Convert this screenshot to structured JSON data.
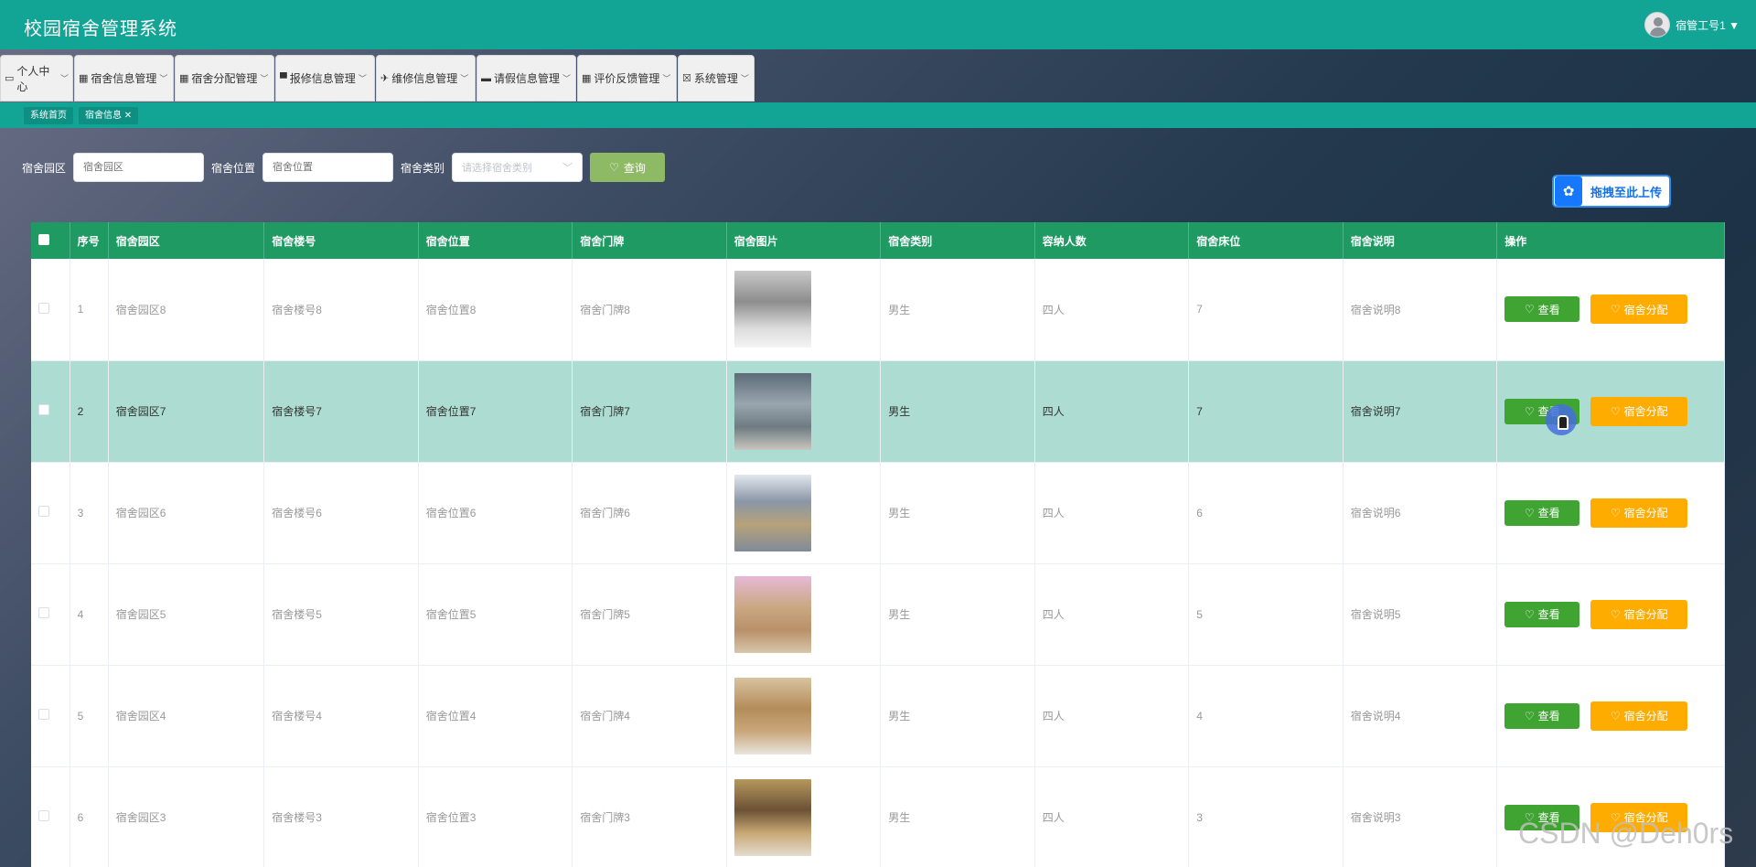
{
  "header": {
    "title": "校园宿舍管理系统",
    "user": "宿管工号1 ▼"
  },
  "menu": [
    {
      "label": "个人中心",
      "icon": "▭"
    },
    {
      "label": "宿舍信息管理",
      "icon": "▦"
    },
    {
      "label": "宿舍分配管理",
      "icon": "▦"
    },
    {
      "label": "报修信息管理",
      "icon": "▀"
    },
    {
      "label": "维修信息管理",
      "icon": "✈"
    },
    {
      "label": "请假信息管理",
      "icon": "▬"
    },
    {
      "label": "评价反馈管理",
      "icon": "▦"
    },
    {
      "label": "系统管理",
      "icon": "☒"
    }
  ],
  "tabs": {
    "home": "系统首页",
    "current": "宿舍信息 ✕"
  },
  "search": {
    "park_label": "宿舍园区",
    "park_placeholder": "宿舍园区",
    "location_label": "宿舍位置",
    "location_placeholder": "宿舍位置",
    "type_label": "宿舍类别",
    "type_placeholder": "请选择宿舍类别",
    "query_label": "查询"
  },
  "upload": {
    "label": "拖拽至此上传"
  },
  "table": {
    "headers": [
      "序号",
      "宿舍园区",
      "宿舍楼号",
      "宿舍位置",
      "宿舍门牌",
      "宿舍图片",
      "宿舍类别",
      "容纳人数",
      "宿舍床位",
      "宿舍说明",
      "操作"
    ],
    "rows": [
      {
        "no": "1",
        "park": "宿舍园区8",
        "building": "宿舍楼号8",
        "location": "宿舍位置8",
        "door": "宿舍门牌8",
        "type": "男生",
        "capacity": "四人",
        "beds": "7",
        "desc": "宿舍说明8"
      },
      {
        "no": "2",
        "park": "宿舍园区7",
        "building": "宿舍楼号7",
        "location": "宿舍位置7",
        "door": "宿舍门牌7",
        "type": "男生",
        "capacity": "四人",
        "beds": "7",
        "desc": "宿舍说明7"
      },
      {
        "no": "3",
        "park": "宿舍园区6",
        "building": "宿舍楼号6",
        "location": "宿舍位置6",
        "door": "宿舍门牌6",
        "type": "男生",
        "capacity": "四人",
        "beds": "6",
        "desc": "宿舍说明6"
      },
      {
        "no": "4",
        "park": "宿舍园区5",
        "building": "宿舍楼号5",
        "location": "宿舍位置5",
        "door": "宿舍门牌5",
        "type": "男生",
        "capacity": "四人",
        "beds": "5",
        "desc": "宿舍说明5"
      },
      {
        "no": "5",
        "park": "宿舍园区4",
        "building": "宿舍楼号4",
        "location": "宿舍位置4",
        "door": "宿舍门牌4",
        "type": "男生",
        "capacity": "四人",
        "beds": "4",
        "desc": "宿舍说明4"
      },
      {
        "no": "6",
        "park": "宿舍园区3",
        "building": "宿舍楼号3",
        "location": "宿舍位置3",
        "door": "宿舍门牌3",
        "type": "男生",
        "capacity": "四人",
        "beds": "3",
        "desc": "宿舍说明3"
      }
    ],
    "view_label": "查看",
    "assign_label": "宿舍分配"
  },
  "watermark": "CSDN @Deh0rs",
  "colors": {
    "header": "#12a596",
    "table_header": "#1e9a62",
    "view": "#3fa432",
    "assign": "#ffac00",
    "query": "#8fba65",
    "highlight_row": "#acdcd2"
  }
}
